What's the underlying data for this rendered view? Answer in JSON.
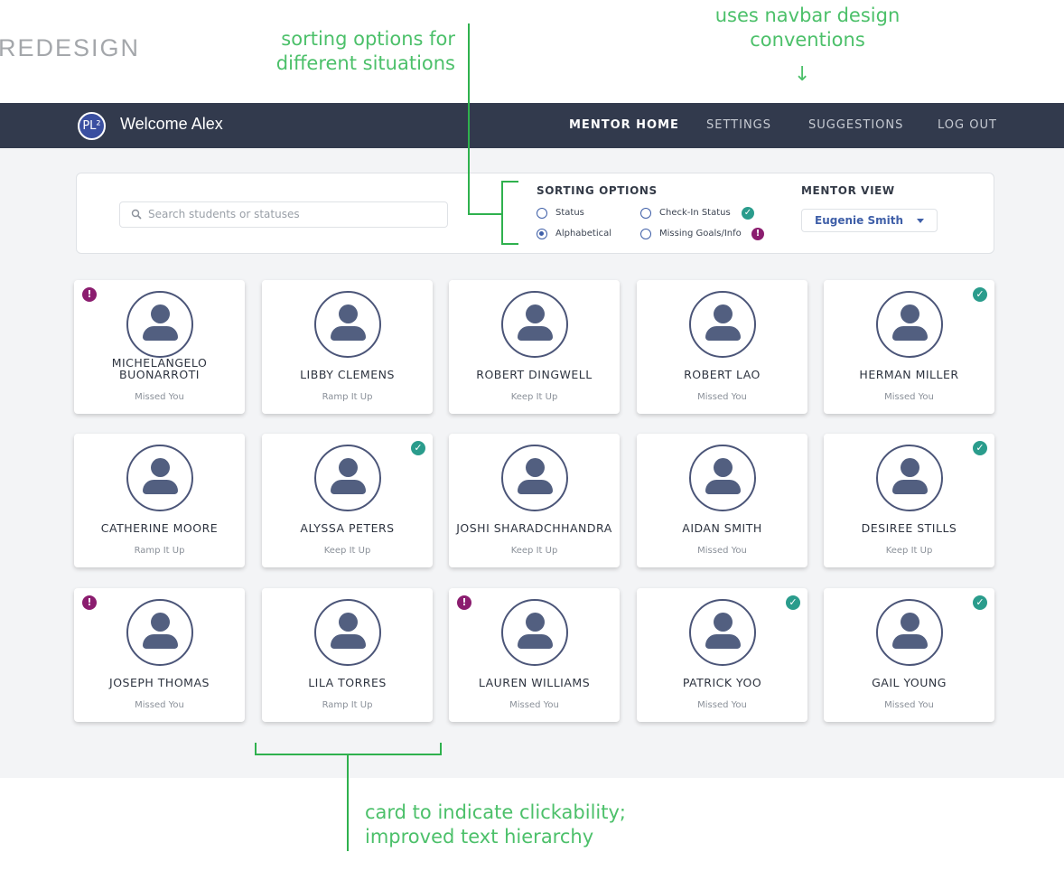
{
  "labels": {
    "redesign": "REDESIGN",
    "annotation_sorting": "sorting options for different situations",
    "annotation_navbar": "uses navbar design conventions",
    "annotation_card": "card to indicate clickability; improved text hierarchy"
  },
  "navbar": {
    "logo_text": "PL²",
    "welcome": "Welcome Alex",
    "links": [
      "MENTOR HOME",
      "SETTINGS",
      "SUGGESTIONS",
      "LOG OUT"
    ],
    "active_link": "MENTOR HOME"
  },
  "search": {
    "placeholder": "Search students or statuses"
  },
  "sorting": {
    "title": "SORTING OPTIONS",
    "options": [
      "Status",
      "Check-In Status",
      "Alphabetical",
      "Missing Goals/Info"
    ],
    "selected": "Alphabetical"
  },
  "mentor_view": {
    "title": "MENTOR VIEW",
    "selected": "Eugenie Smith"
  },
  "students": [
    {
      "name": "MICHELANGELO BUONARROTI",
      "status": "Missed You",
      "badge": "warn"
    },
    {
      "name": "LIBBY CLEMENS",
      "status": "Ramp It Up",
      "badge": ""
    },
    {
      "name": "ROBERT DINGWELL",
      "status": "Keep It Up",
      "badge": ""
    },
    {
      "name": "ROBERT LAO",
      "status": "Missed You",
      "badge": ""
    },
    {
      "name": "HERMAN MILLER",
      "status": "Missed You",
      "badge": "ok"
    },
    {
      "name": "CATHERINE MOORE",
      "status": "Ramp It Up",
      "badge": ""
    },
    {
      "name": "ALYSSA PETERS",
      "status": "Keep It Up",
      "badge": "ok"
    },
    {
      "name": "JOSHI SHARADCHHANDRA",
      "status": "Keep It Up",
      "badge": ""
    },
    {
      "name": "AIDAN SMITH",
      "status": "Missed You",
      "badge": ""
    },
    {
      "name": "DESIREE STILLS",
      "status": "Keep It Up",
      "badge": "ok"
    },
    {
      "name": "JOSEPH THOMAS",
      "status": "Missed You",
      "badge": "warn"
    },
    {
      "name": "LILA TORRES",
      "status": "Ramp It Up",
      "badge": ""
    },
    {
      "name": "LAUREN WILLIAMS",
      "status": "Missed You",
      "badge": "warn"
    },
    {
      "name": "PATRICK YOO",
      "status": "Missed You",
      "badge": "ok"
    },
    {
      "name": "GAIL YOUNG",
      "status": "Missed You",
      "badge": "ok"
    }
  ],
  "colors": {
    "navbar": "#323a4d",
    "annotation_green": "#4cc06a",
    "accent_blue": "#3f5fa8",
    "check_teal": "#2a9c8c",
    "alert_purple": "#8b1d6f"
  },
  "icons": {
    "search": "search-icon",
    "check": "check-icon",
    "alert": "alert-icon",
    "avatar": "user-icon"
  }
}
